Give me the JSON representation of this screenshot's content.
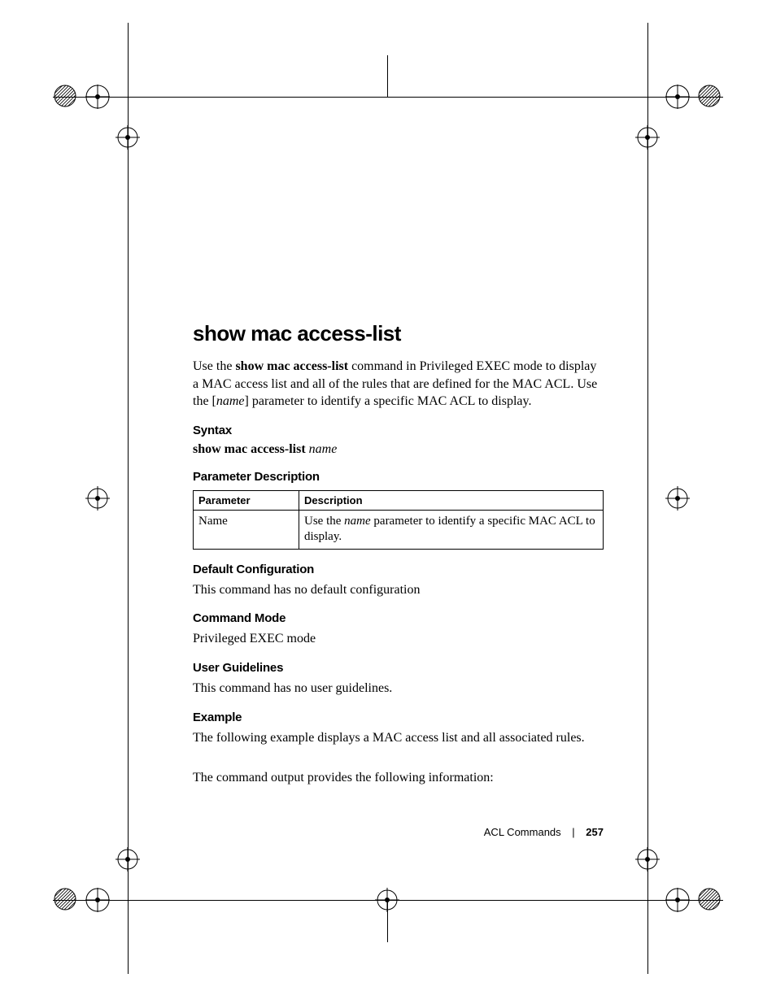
{
  "title": "show mac access-list",
  "intro_parts": {
    "a": "Use the ",
    "b": "show mac access-list",
    "c": " command in Privileged EXEC mode to display a MAC access list and all of the rules that are defined for the MAC ACL. Use the [",
    "d": "name",
    "e": "] parameter to identify a specific MAC ACL to display."
  },
  "syntax": {
    "heading": "Syntax",
    "cmd": "show mac access-list",
    "arg": "name"
  },
  "param_desc": {
    "heading": "Parameter Description",
    "th_param": "Parameter",
    "th_desc": "Description",
    "row1_param": "Name",
    "row1_desc_a": "Use the ",
    "row1_desc_b": "name",
    "row1_desc_c": " parameter to identify a specific MAC ACL to display."
  },
  "default_cfg": {
    "heading": "Default Configuration",
    "body": "This command has no default configuration"
  },
  "mode": {
    "heading": "Command Mode",
    "body": "Privileged EXEC mode"
  },
  "guidelines": {
    "heading": "User Guidelines",
    "body": "This command has no user guidelines."
  },
  "example": {
    "heading": "Example",
    "p1": "The following example displays a MAC access list and all associated rules.",
    "p2": "The command output provides the following information:"
  },
  "footer": {
    "section": "ACL Commands",
    "page": "257"
  }
}
